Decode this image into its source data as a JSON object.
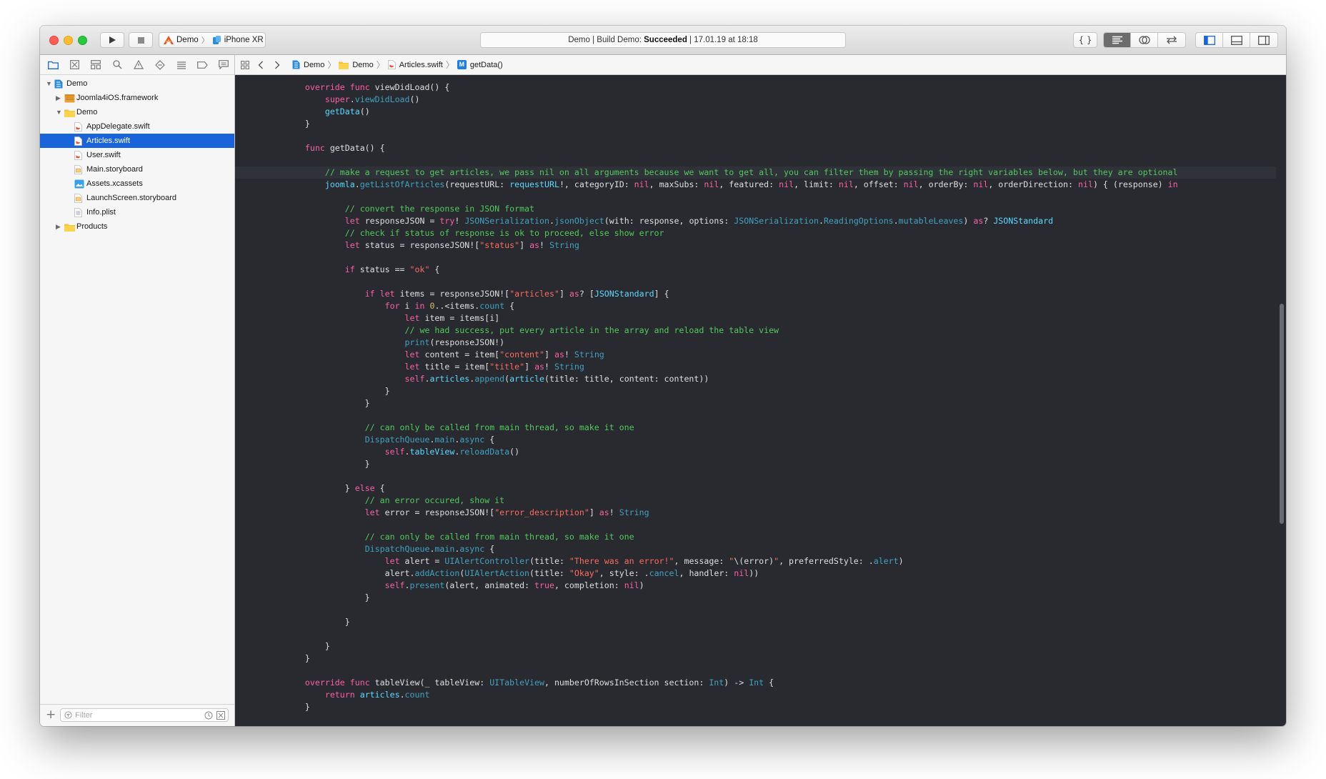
{
  "toolbar": {
    "scheme_target": "Demo",
    "scheme_device": "iPhone XR",
    "activity_prefix": "Demo | Build Demo: ",
    "activity_status": "Succeeded",
    "activity_suffix": " | 17.01.19 at 18:18",
    "icons": [
      "run-icon",
      "stop-icon",
      "library-icon",
      "standard-editor-icon",
      "assistant-editor-icon",
      "version-editor-icon",
      "navigator-toggle-icon",
      "debug-area-toggle-icon",
      "inspector-toggle-icon"
    ]
  },
  "navigator": {
    "tabs": [
      "folder-icon",
      "source-control-icon",
      "symbol-icon",
      "find-icon",
      "issue-icon",
      "test-icon",
      "debug-icon",
      "breakpoint-icon",
      "report-icon"
    ],
    "tree": [
      {
        "label": "Demo",
        "kind": "project",
        "depth": 0,
        "disclosure": "open"
      },
      {
        "label": "Joomla4iOS.framework",
        "kind": "framework",
        "depth": 1,
        "disclosure": "closed"
      },
      {
        "label": "Demo",
        "kind": "folder",
        "depth": 1,
        "disclosure": "open"
      },
      {
        "label": "AppDelegate.swift",
        "kind": "swift",
        "depth": 2
      },
      {
        "label": "Articles.swift",
        "kind": "swift",
        "depth": 2,
        "selected": true
      },
      {
        "label": "User.swift",
        "kind": "swift",
        "depth": 2
      },
      {
        "label": "Main.storyboard",
        "kind": "storyboard",
        "depth": 2
      },
      {
        "label": "Assets.xcassets",
        "kind": "assets",
        "depth": 2
      },
      {
        "label": "LaunchScreen.storyboard",
        "kind": "storyboard",
        "depth": 2
      },
      {
        "label": "Info.plist",
        "kind": "plist",
        "depth": 2
      },
      {
        "label": "Products",
        "kind": "folder",
        "depth": 1,
        "disclosure": "closed"
      }
    ],
    "filter_placeholder": "Filter"
  },
  "jumpbar": {
    "crumbs": [
      "Demo",
      "Demo",
      "Articles.swift",
      "getData()"
    ]
  },
  "editor": {
    "current_line": 7,
    "lines": [
      [
        [
          "    ",
          ""
        ],
        [
          "override",
          "kw"
        ],
        [
          " ",
          ""
        ],
        [
          "func",
          "kw"
        ],
        [
          " viewDidLoad() {",
          ""
        ]
      ],
      [
        [
          "        ",
          ""
        ],
        [
          "super",
          "kw"
        ],
        [
          ".",
          ""
        ],
        [
          "viewDidLoad",
          "ap"
        ],
        [
          "()",
          ""
        ]
      ],
      [
        [
          "        ",
          ""
        ],
        [
          "getData",
          "ty"
        ],
        [
          "()",
          ""
        ]
      ],
      [
        [
          "    }",
          ""
        ]
      ],
      [
        [
          "",
          ""
        ]
      ],
      [
        [
          "    ",
          ""
        ],
        [
          "func",
          "kw"
        ],
        [
          " getData() {",
          ""
        ]
      ],
      [
        [
          "",
          ""
        ]
      ],
      [
        [
          "        ",
          ""
        ],
        [
          "// make a request to get articles, we pass nil on all arguments because we want to get all, you can filter them by passing the right variables below, but they are optional",
          "cm"
        ]
      ],
      [
        [
          "        ",
          ""
        ],
        [
          "joomla",
          "ty"
        ],
        [
          ".",
          ""
        ],
        [
          "getListOfArticles",
          "ap"
        ],
        [
          "(requestURL: ",
          ""
        ],
        [
          "requestURL",
          "ty"
        ],
        [
          "!, categoryID: ",
          ""
        ],
        [
          "nil",
          "kw"
        ],
        [
          ", maxSubs: ",
          ""
        ],
        [
          "nil",
          "kw"
        ],
        [
          ", featured: ",
          ""
        ],
        [
          "nil",
          "kw"
        ],
        [
          ", limit: ",
          ""
        ],
        [
          "nil",
          "kw"
        ],
        [
          ", offset: ",
          ""
        ],
        [
          "nil",
          "kw"
        ],
        [
          ", orderBy: ",
          ""
        ],
        [
          "nil",
          "kw"
        ],
        [
          ", orderDirection: ",
          ""
        ],
        [
          "nil",
          "kw"
        ],
        [
          ") { (response) ",
          ""
        ],
        [
          "in",
          "kw"
        ]
      ],
      [
        [
          "",
          ""
        ]
      ],
      [
        [
          "            ",
          ""
        ],
        [
          "// convert the response in JSON format",
          "cm"
        ]
      ],
      [
        [
          "            ",
          ""
        ],
        [
          "let",
          "kw"
        ],
        [
          " responseJSON = ",
          ""
        ],
        [
          "try",
          "kw"
        ],
        [
          "! ",
          ""
        ],
        [
          "JSONSerialization",
          "ap"
        ],
        [
          ".",
          ""
        ],
        [
          "jsonObject",
          "ap"
        ],
        [
          "(with: response, options: ",
          ""
        ],
        [
          "JSONSerialization",
          "ap"
        ],
        [
          ".",
          ""
        ],
        [
          "ReadingOptions",
          "ap"
        ],
        [
          ".",
          ""
        ],
        [
          "mutableLeaves",
          "ap"
        ],
        [
          ") ",
          ""
        ],
        [
          "as",
          "kw"
        ],
        [
          "? ",
          ""
        ],
        [
          "JSONStandard",
          "ty"
        ]
      ],
      [
        [
          "            ",
          ""
        ],
        [
          "// check if status of response is ok to proceed, else show error",
          "cm"
        ]
      ],
      [
        [
          "            ",
          ""
        ],
        [
          "let",
          "kw"
        ],
        [
          " status = responseJSON![",
          ""
        ],
        [
          "\"status\"",
          "st"
        ],
        [
          "] ",
          ""
        ],
        [
          "as",
          "kw"
        ],
        [
          "! ",
          ""
        ],
        [
          "String",
          "ap"
        ]
      ],
      [
        [
          "",
          ""
        ]
      ],
      [
        [
          "            ",
          ""
        ],
        [
          "if",
          "kw"
        ],
        [
          " status == ",
          ""
        ],
        [
          "\"ok\"",
          "st"
        ],
        [
          " {",
          ""
        ]
      ],
      [
        [
          "",
          ""
        ]
      ],
      [
        [
          "                ",
          ""
        ],
        [
          "if",
          "kw"
        ],
        [
          " ",
          ""
        ],
        [
          "let",
          "kw"
        ],
        [
          " items = responseJSON![",
          ""
        ],
        [
          "\"articles\"",
          "st"
        ],
        [
          "] ",
          ""
        ],
        [
          "as",
          "kw"
        ],
        [
          "? [",
          ""
        ],
        [
          "JSONStandard",
          "ty"
        ],
        [
          "] {",
          ""
        ]
      ],
      [
        [
          "                    ",
          ""
        ],
        [
          "for",
          "kw"
        ],
        [
          " i ",
          ""
        ],
        [
          "in",
          "kw"
        ],
        [
          " ",
          ""
        ],
        [
          "0",
          "nm"
        ],
        [
          "..<items.",
          ""
        ],
        [
          "count",
          "ap"
        ],
        [
          " {",
          ""
        ]
      ],
      [
        [
          "                        ",
          ""
        ],
        [
          "let",
          "kw"
        ],
        [
          " item = items[i]",
          ""
        ]
      ],
      [
        [
          "                        ",
          ""
        ],
        [
          "// we had success, put every article in the array and reload the table view",
          "cm"
        ]
      ],
      [
        [
          "                        ",
          ""
        ],
        [
          "print",
          "ap"
        ],
        [
          "(responseJSON!)",
          ""
        ]
      ],
      [
        [
          "                        ",
          ""
        ],
        [
          "let",
          "kw"
        ],
        [
          " content = item[",
          ""
        ],
        [
          "\"content\"",
          "st"
        ],
        [
          "] ",
          ""
        ],
        [
          "as",
          "kw"
        ],
        [
          "! ",
          ""
        ],
        [
          "String",
          "ap"
        ]
      ],
      [
        [
          "                        ",
          ""
        ],
        [
          "let",
          "kw"
        ],
        [
          " title = item[",
          ""
        ],
        [
          "\"title\"",
          "st"
        ],
        [
          "] ",
          ""
        ],
        [
          "as",
          "kw"
        ],
        [
          "! ",
          ""
        ],
        [
          "String",
          "ap"
        ]
      ],
      [
        [
          "                        ",
          ""
        ],
        [
          "self",
          "kw"
        ],
        [
          ".",
          ""
        ],
        [
          "articles",
          "ty"
        ],
        [
          ".",
          ""
        ],
        [
          "append",
          "ap"
        ],
        [
          "(",
          ""
        ],
        [
          "article",
          "ty"
        ],
        [
          "(title: title, content: content))",
          ""
        ]
      ],
      [
        [
          "                    }",
          ""
        ]
      ],
      [
        [
          "                }",
          ""
        ]
      ],
      [
        [
          "",
          ""
        ]
      ],
      [
        [
          "                ",
          ""
        ],
        [
          "// can only be called from main thread, so make it one",
          "cm"
        ]
      ],
      [
        [
          "                ",
          ""
        ],
        [
          "DispatchQueue",
          "ap"
        ],
        [
          ".",
          ""
        ],
        [
          "main",
          "ap"
        ],
        [
          ".",
          ""
        ],
        [
          "async",
          "ap"
        ],
        [
          " {",
          ""
        ]
      ],
      [
        [
          "                    ",
          ""
        ],
        [
          "self",
          "kw"
        ],
        [
          ".",
          ""
        ],
        [
          "tableView",
          "ty"
        ],
        [
          ".",
          ""
        ],
        [
          "reloadData",
          "ap"
        ],
        [
          "()",
          ""
        ]
      ],
      [
        [
          "                }",
          ""
        ]
      ],
      [
        [
          "",
          ""
        ]
      ],
      [
        [
          "            } ",
          ""
        ],
        [
          "else",
          "kw"
        ],
        [
          " {",
          ""
        ]
      ],
      [
        [
          "                ",
          ""
        ],
        [
          "// an error occured, show it",
          "cm"
        ]
      ],
      [
        [
          "                ",
          ""
        ],
        [
          "let",
          "kw"
        ],
        [
          " error = responseJSON![",
          ""
        ],
        [
          "\"error_description\"",
          "st"
        ],
        [
          "] ",
          ""
        ],
        [
          "as",
          "kw"
        ],
        [
          "! ",
          ""
        ],
        [
          "String",
          "ap"
        ]
      ],
      [
        [
          "",
          ""
        ]
      ],
      [
        [
          "                ",
          ""
        ],
        [
          "// can only be called from main thread, so make it one",
          "cm"
        ]
      ],
      [
        [
          "                ",
          ""
        ],
        [
          "DispatchQueue",
          "ap"
        ],
        [
          ".",
          ""
        ],
        [
          "main",
          "ap"
        ],
        [
          ".",
          ""
        ],
        [
          "async",
          "ap"
        ],
        [
          " {",
          ""
        ]
      ],
      [
        [
          "                    ",
          ""
        ],
        [
          "let",
          "kw"
        ],
        [
          " alert = ",
          ""
        ],
        [
          "UIAlertController",
          "ap"
        ],
        [
          "(title: ",
          ""
        ],
        [
          "\"There was an error!\"",
          "st"
        ],
        [
          ", message: ",
          ""
        ],
        [
          "\"",
          "st"
        ],
        [
          "\\(error)",
          ""
        ],
        [
          "\"",
          "st"
        ],
        [
          ", preferredStyle: .",
          ""
        ],
        [
          "alert",
          "ap"
        ],
        [
          ")",
          ""
        ]
      ],
      [
        [
          "                    alert.",
          ""
        ],
        [
          "addAction",
          "ap"
        ],
        [
          "(",
          ""
        ],
        [
          "UIAlertAction",
          "ap"
        ],
        [
          "(title: ",
          ""
        ],
        [
          "\"Okay\"",
          "st"
        ],
        [
          ", style: .",
          ""
        ],
        [
          "cancel",
          "ap"
        ],
        [
          ", handler: ",
          ""
        ],
        [
          "nil",
          "kw"
        ],
        [
          "))",
          ""
        ]
      ],
      [
        [
          "                    ",
          ""
        ],
        [
          "self",
          "kw"
        ],
        [
          ".",
          ""
        ],
        [
          "present",
          "ap"
        ],
        [
          "(alert, animated: ",
          ""
        ],
        [
          "true",
          "kw"
        ],
        [
          ", completion: ",
          ""
        ],
        [
          "nil",
          "kw"
        ],
        [
          ")",
          ""
        ]
      ],
      [
        [
          "                }",
          ""
        ]
      ],
      [
        [
          "",
          ""
        ]
      ],
      [
        [
          "            }",
          ""
        ]
      ],
      [
        [
          "",
          ""
        ]
      ],
      [
        [
          "        }",
          ""
        ]
      ],
      [
        [
          "    }",
          ""
        ]
      ],
      [
        [
          "",
          ""
        ]
      ],
      [
        [
          "    ",
          ""
        ],
        [
          "override",
          "kw"
        ],
        [
          " ",
          ""
        ],
        [
          "func",
          "kw"
        ],
        [
          " tableView(_ tableView: ",
          ""
        ],
        [
          "UITableView",
          "ap"
        ],
        [
          ", numberOfRowsInSection section: ",
          ""
        ],
        [
          "Int",
          "ap"
        ],
        [
          ") -> ",
          ""
        ],
        [
          "Int",
          "ap"
        ],
        [
          " {",
          ""
        ]
      ],
      [
        [
          "        ",
          ""
        ],
        [
          "return",
          "kw"
        ],
        [
          " ",
          ""
        ],
        [
          "articles",
          "ty"
        ],
        [
          ".",
          ""
        ],
        [
          "count",
          "ap"
        ]
      ],
      [
        [
          "    }",
          ""
        ]
      ]
    ]
  }
}
